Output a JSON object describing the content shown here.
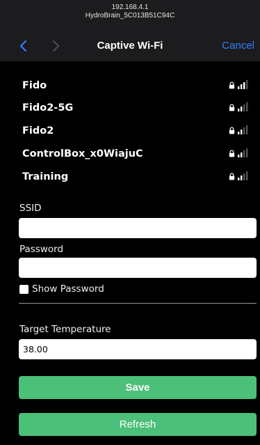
{
  "browser": {
    "address_ip": "192.168.4.1",
    "address_host": "HydroBrain_5C013B51C94C"
  },
  "nav": {
    "back_icon": "chevron-left-icon",
    "forward_icon": "chevron-right-icon",
    "title": "Captive Wi-Fi",
    "cancel_label": "Cancel",
    "accent_color": "#2f80ff"
  },
  "networks": [
    {
      "name": "Fido",
      "locked": true,
      "signal_bars": 3
    },
    {
      "name": "Fido2-5G",
      "locked": true,
      "signal_bars": 2
    },
    {
      "name": "Fido2",
      "locked": true,
      "signal_bars": 2
    },
    {
      "name": "ControlBox_x0WiajuC",
      "locked": true,
      "signal_bars": 2
    },
    {
      "name": "Training",
      "locked": true,
      "signal_bars": 2
    }
  ],
  "form": {
    "ssid_label": "SSID",
    "ssid_value": "",
    "password_label": "Password",
    "password_value": "",
    "show_password_label": "Show Password",
    "show_password_checked": false,
    "target_temp_label": "Target Temperature",
    "target_temp_value": "38.00"
  },
  "buttons": {
    "save_label": "Save",
    "refresh_label": "Refresh",
    "button_color": "#4cbf78"
  }
}
